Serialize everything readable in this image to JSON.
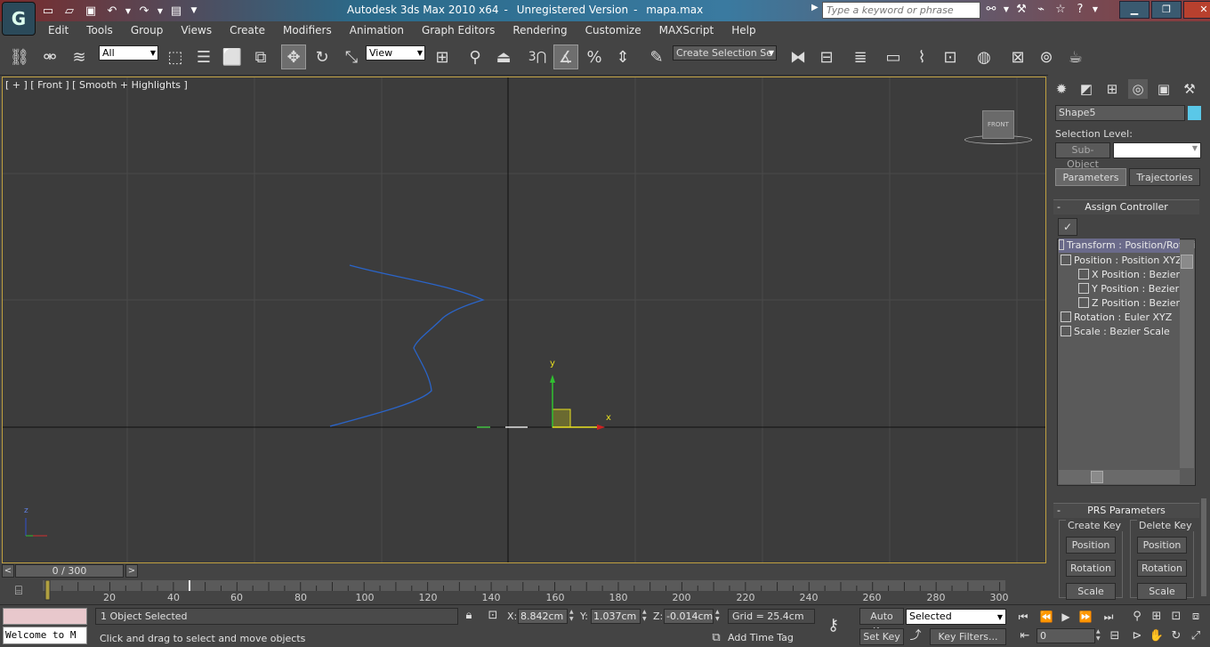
{
  "window": {
    "app_name": "Autodesk 3ds Max  2010 x64",
    "license": "Unregistered Version",
    "file": "mapa.max"
  },
  "search": {
    "placeholder": "Type a keyword or phrase"
  },
  "menu": [
    "Edit",
    "Tools",
    "Group",
    "Views",
    "Create",
    "Modifiers",
    "Animation",
    "Graph Editors",
    "Rendering",
    "Customize",
    "MAXScript",
    "Help"
  ],
  "toolbar": {
    "filter_value": "All",
    "ref_coord_value": "View",
    "snap_number": "3",
    "selection_set_value": "Create Selection Se"
  },
  "viewport": {
    "label": "[ + ] [ Front ] [ Smooth + Highlights ]",
    "viewcube_label": "FRONT",
    "axis_x": "x",
    "axis_y": "y",
    "corner_axis_z": "z"
  },
  "command_panel": {
    "object_name": "Shape5",
    "object_color": "#5ac8e8",
    "selection_level_label": "Selection Level:",
    "sub_object_label": "Sub-Object",
    "tabs": [
      "Parameters",
      "Trajectories"
    ],
    "assign_controller": {
      "title": "Assign Controller",
      "tree": [
        "Transform : Position/Rotati",
        "Position : Position XYZ",
        "X Position : Bezier Fl",
        "Y Position : Bezier Fl",
        "Z Position : Bezier Fl",
        "Rotation : Euler XYZ",
        "Scale : Bezier Scale"
      ]
    },
    "prs": {
      "title": "PRS Parameters",
      "create_key_label": "Create Key",
      "delete_key_label": "Delete Key",
      "buttons": [
        "Position",
        "Rotation",
        "Scale"
      ]
    }
  },
  "timeline": {
    "slider_text": "0 / 300",
    "ticks": [
      "20",
      "40",
      "60",
      "80",
      "100",
      "120",
      "140",
      "160",
      "180",
      "200",
      "220",
      "240",
      "260",
      "280",
      "300"
    ]
  },
  "status": {
    "maxscript_text": "Welcome to M",
    "selection": "1 Object Selected",
    "prompt": "Click and drag to select and move objects",
    "x_label": "X:",
    "x_value": "8.842cm",
    "y_label": "Y:",
    "y_value": "1.037cm",
    "z_label": "Z:",
    "z_value": "-0.014cm",
    "grid": "Grid = 25.4cm",
    "add_time_tag": "Add Time Tag",
    "auto_key": "Auto Key",
    "set_key": "Set Key",
    "selected": "Selected",
    "key_filters": "Key Filters...",
    "frame": "0"
  }
}
